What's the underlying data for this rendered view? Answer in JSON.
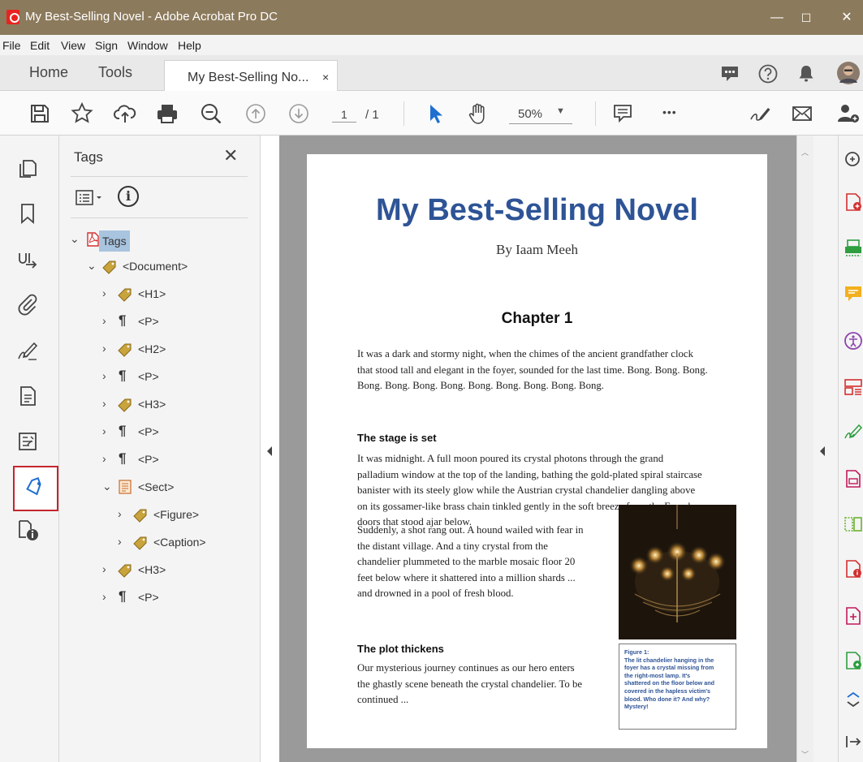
{
  "window": {
    "title": "My Best-Selling Novel - Adobe Acrobat Pro DC",
    "controls": {
      "minimize": "—",
      "maximize": "☐",
      "close": "✕"
    }
  },
  "menu": [
    "File",
    "Edit",
    "View",
    "Sign",
    "Window",
    "Help"
  ],
  "tabs": {
    "home": "Home",
    "tools": "Tools",
    "document": "My Best-Selling No...",
    "close": "×"
  },
  "toolbar": {
    "page_current": "1",
    "page_total": "/ 1",
    "zoom": "50%",
    "more": "•••"
  },
  "tags_panel": {
    "title": "Tags",
    "close": "✕",
    "info_glyph": "i",
    "tree": [
      {
        "label": "Tags",
        "expanded": true,
        "icon": "pdf-icon"
      },
      {
        "label": "<Document>",
        "expanded": true,
        "icon": "tag-icon"
      },
      {
        "label": "<H1>",
        "icon": "tag-icon"
      },
      {
        "label": "<P>",
        "icon": "paragraph-icon"
      },
      {
        "label": "<H2>",
        "icon": "tag-icon"
      },
      {
        "label": "<P>",
        "icon": "paragraph-icon"
      },
      {
        "label": "<H3>",
        "icon": "tag-icon"
      },
      {
        "label": "<P>",
        "icon": "paragraph-icon"
      },
      {
        "label": "<P>",
        "icon": "paragraph-icon"
      },
      {
        "label": "<Sect>",
        "expanded": true,
        "icon": "sect-icon"
      },
      {
        "label": "<Figure>",
        "icon": "tag-icon"
      },
      {
        "label": "<Caption>",
        "icon": "tag-icon"
      },
      {
        "label": "<H3>",
        "icon": "tag-icon"
      },
      {
        "label": "<P>",
        "icon": "paragraph-icon"
      }
    ],
    "glyphs": {
      "expanded": "⌄",
      "collapsed": "›",
      "pilcrow": "¶"
    }
  },
  "document": {
    "title": "My Best-Selling Novel",
    "byline": "By Iaam Meeh",
    "chapter": "Chapter 1",
    "para1": [
      "It was a dark and stormy night, when the chimes of the ancient grandfather clock",
      "that stood tall and elegant in the foyer, sounded for the last time. Bong. Bong. Bong.",
      "Bong. Bong. Bong. Bong. Bong. Bong. Bong. Bong. Bong."
    ],
    "heading1": "The stage is set",
    "para2": [
      "It was midnight. A full moon poured its crystal photons through the grand",
      "palladium window at the top of the landing, bathing the gold-plated spiral staircase",
      "banister with its steely glow while the Austrian crystal chandelier dangling above",
      "on its gossamer-like brass chain tinkled gently in the soft breeze from the French",
      "doors that stood ajar below."
    ],
    "para3": [
      "Suddenly, a shot rang out. A hound wailed with fear in",
      "the distant village. And a tiny crystal from the",
      "chandelier plummeted to the marble mosaic floor 20",
      "feet below where it shattered into a million shards ...",
      "and drowned in a pool of fresh blood."
    ],
    "heading2": "The plot thickens",
    "para4": [
      "Our mysterious journey continues as our hero enters",
      "the ghastly scene beneath the crystal chandelier. To be",
      "continued ..."
    ],
    "caption": [
      "Figure 1:",
      "The lit chandelier hanging in the",
      "foyer has a crystal missing from",
      "the right-most lamp. It's",
      "shattered on the floor below and",
      "covered in the hapless victim's",
      "blood. Who done it? And why?",
      "Mystery!"
    ]
  },
  "colors": {
    "titlebar": "#8c7a5c",
    "heading_blue": "#2e5496",
    "active_rail_border": "#c4262e",
    "selection": "#a9c4df"
  }
}
